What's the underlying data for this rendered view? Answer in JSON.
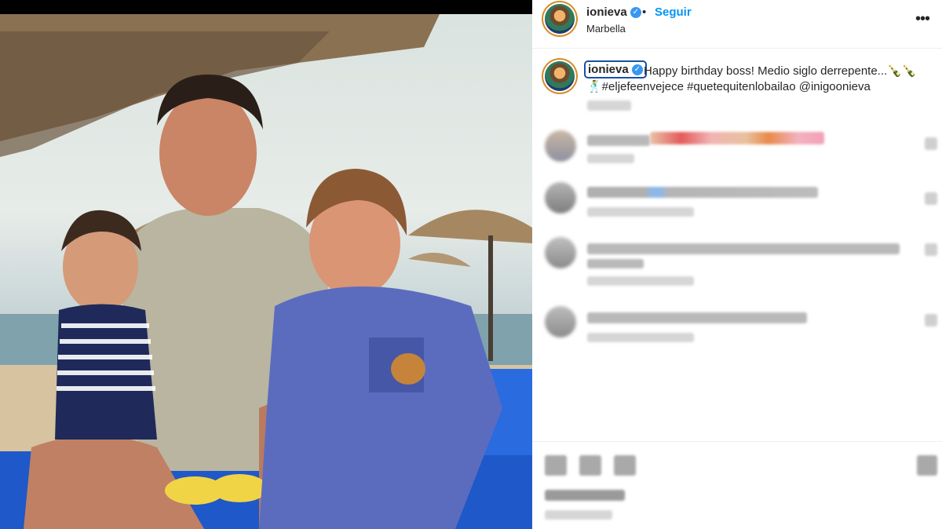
{
  "post": {
    "author": {
      "username": "ionieva",
      "verified": true,
      "follow_label": "Seguir",
      "separator": "•",
      "location": "Marbella"
    },
    "caption": {
      "username": "ionieva",
      "line1": "Happy birthday boss! Medio siglo derrepente...🍾🍾",
      "line2": "🕺#eljefeenvejece #quetequitenlobailao @inigoonieva"
    }
  },
  "icons": {
    "more": "more-options-icon",
    "verified": "verified-badge-icon"
  },
  "colors": {
    "follow_link": "#0095f6",
    "verified_badge": "#3897f0",
    "avatar_ring": "#d98b2b",
    "focus_outline": "#1a4fa8"
  }
}
